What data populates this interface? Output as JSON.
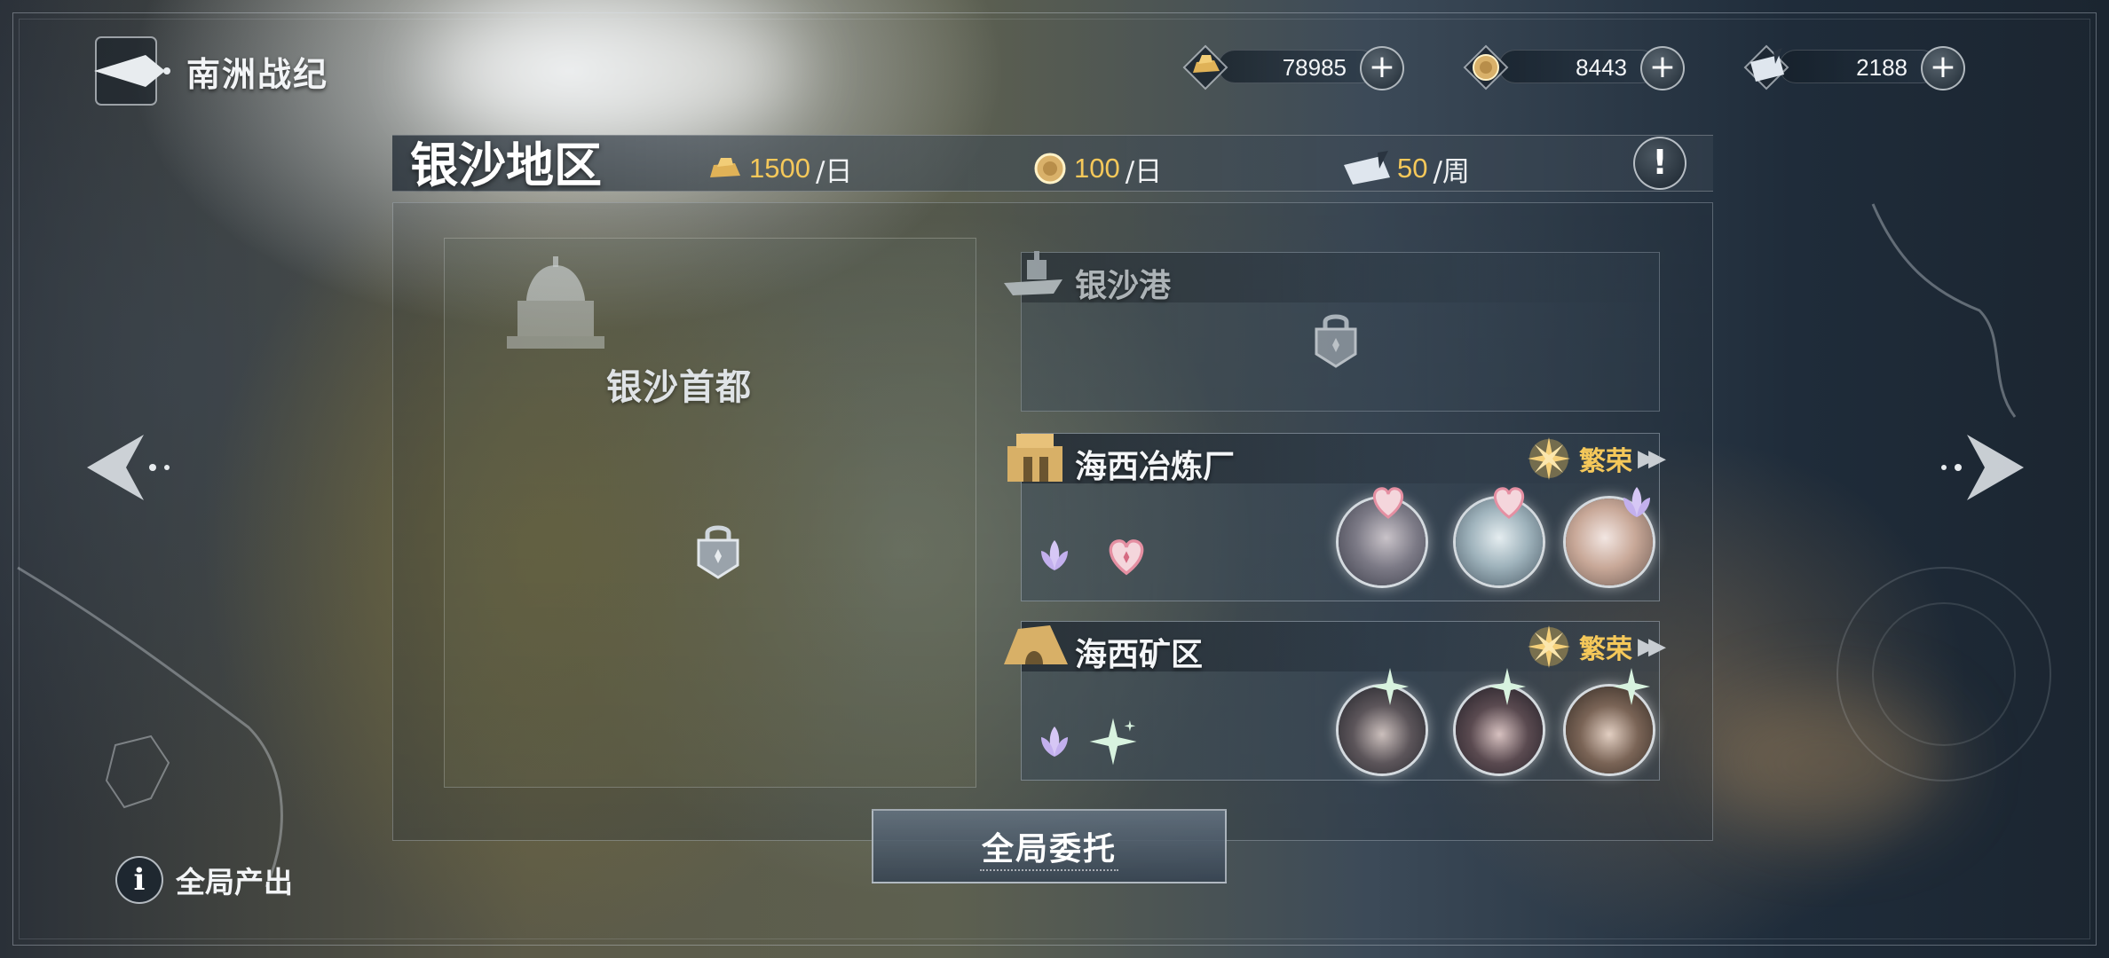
{
  "game_title": "南洲战纪",
  "currencies": [
    {
      "icon": "gold-ingot-icon",
      "value": "78985"
    },
    {
      "icon": "coin-icon",
      "value": "8443"
    },
    {
      "icon": "letter-icon",
      "value": "2188"
    }
  ],
  "region": {
    "name": "银沙地区",
    "production": [
      {
        "icon": "gold-ingot-icon",
        "amount": "1500",
        "unit": "/日"
      },
      {
        "icon": "coin-icon",
        "amount": "100",
        "unit": "/日"
      },
      {
        "icon": "letter-icon",
        "amount": "50",
        "unit": "/周"
      }
    ],
    "info_icon": "!"
  },
  "capital": {
    "name": "银沙首都",
    "locked": true
  },
  "districts": [
    {
      "name": "银沙港",
      "locked": true
    },
    {
      "name": "海西冶炼厂",
      "status": "繁荣",
      "traits": [
        "lotus-icon",
        "heart-icon"
      ],
      "portraits": 3
    },
    {
      "name": "海西矿区",
      "status": "繁荣",
      "traits": [
        "lotus-icon",
        "sparkle-icon"
      ],
      "portraits": 3
    }
  ],
  "buttons": {
    "delegate": "全局委托",
    "global_output": "全局产出",
    "info_glyph": "i"
  },
  "colors": {
    "accent_gold": "#f5c85a",
    "text": "#f2f4f6"
  }
}
